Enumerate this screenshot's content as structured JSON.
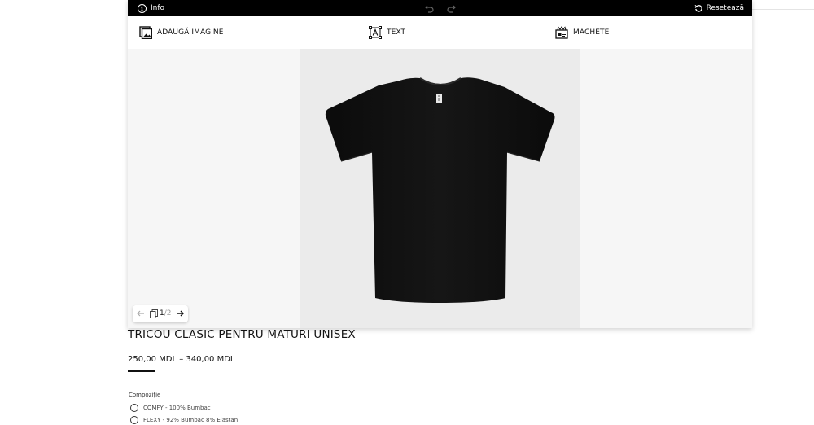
{
  "topbar": {
    "info_label": "Info",
    "info_glyph": "i",
    "reset_label": "Resetează"
  },
  "toolbar": {
    "add_image_label": "ADAUGĂ IMAGINE",
    "text_label": "TEXT",
    "templates_label": "MACHETE"
  },
  "pager": {
    "current": "1",
    "total": "/2"
  },
  "product": {
    "title": "TRICOU CLASIC PENTRU MATURI UNISEX",
    "price": "250,00 MDL – 340,00 MDL",
    "composition_label": "Compoziție",
    "options": [
      {
        "label": "COMFY - 100% Bumbac"
      },
      {
        "label": "FLEXY - 92% Bumbac 8% Elastan"
      }
    ]
  },
  "colors": {
    "topbar_bg": "#000000",
    "canvas_bg": "#ebebeb",
    "editor_bg": "#f6f6f6",
    "shirt": "#0a0a0a"
  }
}
